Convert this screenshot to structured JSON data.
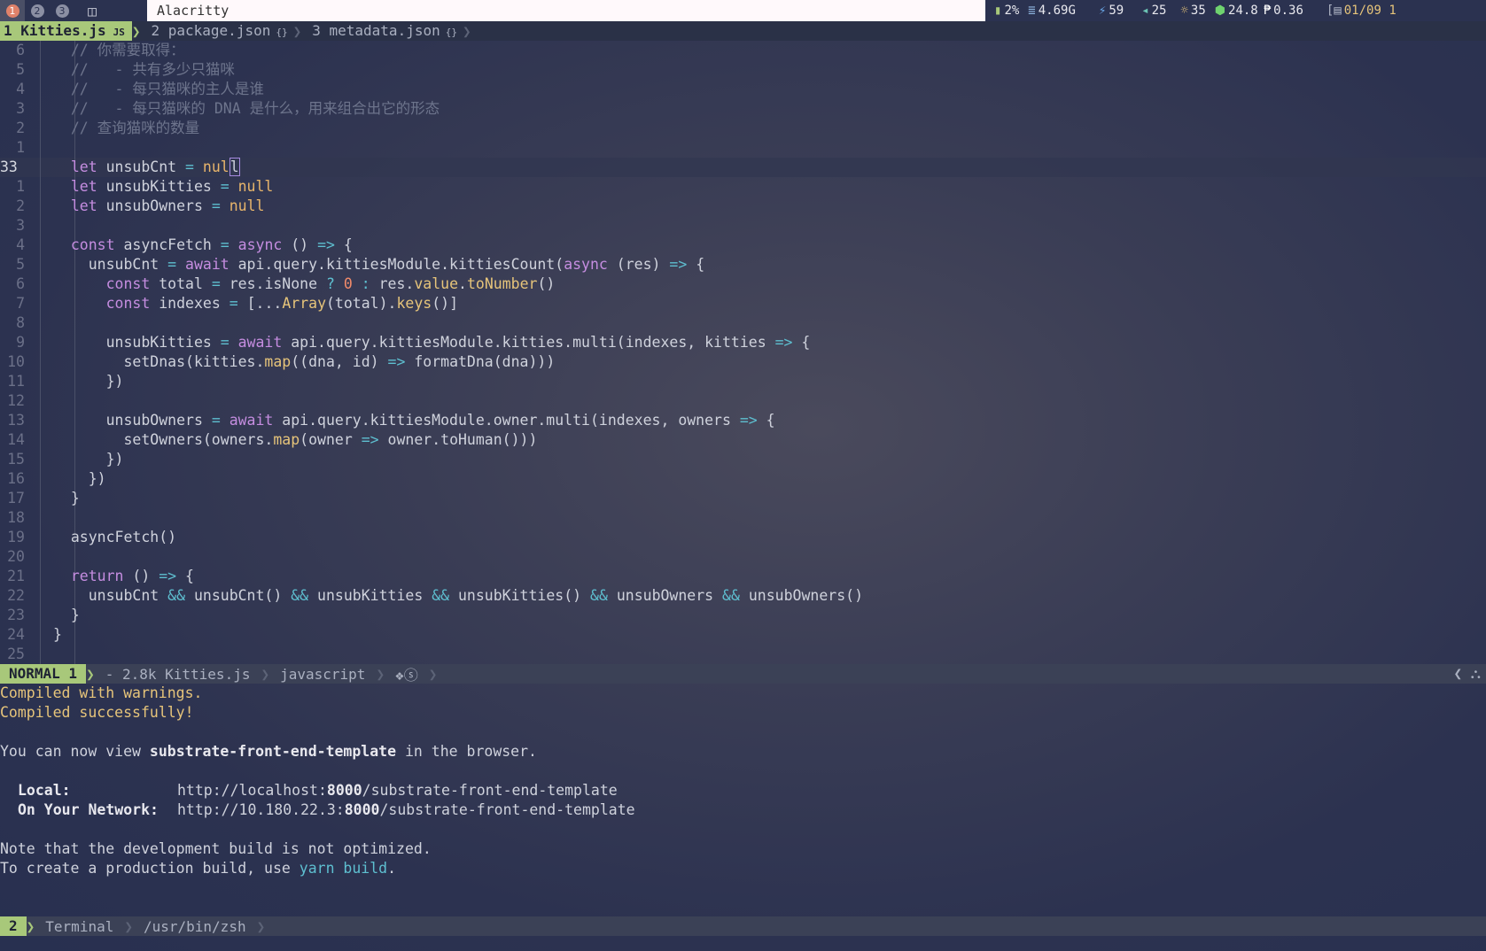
{
  "topbar": {
    "workspaces": [
      "1",
      "2",
      "3"
    ],
    "window_title": "Alacritty",
    "status": {
      "battery": "2%",
      "memory": "4.69G",
      "power": "59",
      "volume": "25",
      "brightness": "35",
      "temp": "24.8",
      "load": "0.36",
      "date": "01/09 1"
    }
  },
  "tabs": [
    {
      "label": "1 Kitties.js",
      "badge": "JS"
    },
    {
      "label": "2 package.json",
      "badge": "{}"
    },
    {
      "label": "3 metadata.json",
      "badge": "{}"
    }
  ],
  "editor": {
    "lines": [
      {
        "n": "6",
        "tokens": [
          [
            "cm",
            "  // 你需要取得："
          ]
        ]
      },
      {
        "n": "5",
        "tokens": [
          [
            "cm",
            "  //   - 共有多少只猫咪"
          ]
        ]
      },
      {
        "n": "4",
        "tokens": [
          [
            "cm",
            "  //   - 每只猫咪的主人是谁"
          ]
        ]
      },
      {
        "n": "3",
        "tokens": [
          [
            "cm",
            "  //   - 每只猫咪的 DNA 是什么，用来组合出它的形态"
          ]
        ]
      },
      {
        "n": "2",
        "tokens": [
          [
            "cm",
            "  // 查询猫咪的数量"
          ]
        ]
      },
      {
        "n": "1",
        "tokens": []
      },
      {
        "n": "33",
        "cur": true,
        "tokens": [
          [
            "kw",
            "  let "
          ],
          [
            "pl",
            "unsubCnt "
          ],
          [
            "op",
            "= "
          ],
          [
            "nl",
            "nul"
          ],
          [
            "cursor",
            "l"
          ]
        ]
      },
      {
        "n": "1",
        "tokens": [
          [
            "kw",
            "  let "
          ],
          [
            "pl",
            "unsubKitties "
          ],
          [
            "op",
            "= "
          ],
          [
            "nl",
            "null"
          ]
        ]
      },
      {
        "n": "2",
        "tokens": [
          [
            "kw",
            "  let "
          ],
          [
            "pl",
            "unsubOwners "
          ],
          [
            "op",
            "= "
          ],
          [
            "nl",
            "null"
          ]
        ]
      },
      {
        "n": "3",
        "tokens": []
      },
      {
        "n": "4",
        "tokens": [
          [
            "kw",
            "  const "
          ],
          [
            "pl",
            "asyncFetch "
          ],
          [
            "op",
            "= "
          ],
          [
            "kw",
            "async "
          ],
          [
            "pl",
            "() "
          ],
          [
            "op",
            "=> "
          ],
          [
            "pl",
            "{"
          ]
        ]
      },
      {
        "n": "5",
        "tokens": [
          [
            "pl",
            "    unsubCnt "
          ],
          [
            "op",
            "= "
          ],
          [
            "kw",
            "await "
          ],
          [
            "pl",
            "api.query.kittiesModule.kittiesCount("
          ],
          [
            "kw",
            "async "
          ],
          [
            "pl",
            "(res) "
          ],
          [
            "op",
            "=> "
          ],
          [
            "pl",
            "{"
          ]
        ]
      },
      {
        "n": "6",
        "tokens": [
          [
            "kw",
            "      const "
          ],
          [
            "pl",
            "total "
          ],
          [
            "op",
            "= "
          ],
          [
            "pl",
            "res.isNone "
          ],
          [
            "op",
            "? "
          ],
          [
            "nm",
            "0 "
          ],
          [
            "op",
            ": "
          ],
          [
            "pl",
            "res."
          ],
          [
            "fn",
            "value"
          ],
          [
            "pl",
            "."
          ],
          [
            "fn",
            "toNumber"
          ],
          [
            "pl",
            "()"
          ]
        ]
      },
      {
        "n": "7",
        "tokens": [
          [
            "kw",
            "      const "
          ],
          [
            "pl",
            "indexes "
          ],
          [
            "op",
            "= "
          ],
          [
            "pl",
            "[..."
          ],
          [
            "fn",
            "Array"
          ],
          [
            "pl",
            "(total)."
          ],
          [
            "fn",
            "keys"
          ],
          [
            "pl",
            "()]"
          ]
        ]
      },
      {
        "n": "8",
        "tokens": []
      },
      {
        "n": "9",
        "tokens": [
          [
            "pl",
            "      unsubKitties "
          ],
          [
            "op",
            "= "
          ],
          [
            "kw",
            "await "
          ],
          [
            "pl",
            "api.query.kittiesModule.kitties.multi(indexes, kitties "
          ],
          [
            "op",
            "=> "
          ],
          [
            "pl",
            "{"
          ]
        ]
      },
      {
        "n": "10",
        "tokens": [
          [
            "pl",
            "        setDnas(kitties."
          ],
          [
            "fn",
            "map"
          ],
          [
            "pl",
            "((dna, id) "
          ],
          [
            "op",
            "=> "
          ],
          [
            "pl",
            "formatDna(dna)))"
          ]
        ]
      },
      {
        "n": "11",
        "tokens": [
          [
            "pl",
            "      })"
          ]
        ]
      },
      {
        "n": "12",
        "tokens": []
      },
      {
        "n": "13",
        "tokens": [
          [
            "pl",
            "      unsubOwners "
          ],
          [
            "op",
            "= "
          ],
          [
            "kw",
            "await "
          ],
          [
            "pl",
            "api.query.kittiesModule.owner.multi(indexes, owners "
          ],
          [
            "op",
            "=> "
          ],
          [
            "pl",
            "{"
          ]
        ]
      },
      {
        "n": "14",
        "tokens": [
          [
            "pl",
            "        setOwners(owners."
          ],
          [
            "fn",
            "map"
          ],
          [
            "pl",
            "(owner "
          ],
          [
            "op",
            "=> "
          ],
          [
            "pl",
            "owner.toHuman()))"
          ]
        ]
      },
      {
        "n": "15",
        "tokens": [
          [
            "pl",
            "      })"
          ]
        ]
      },
      {
        "n": "16",
        "tokens": [
          [
            "pl",
            "    })"
          ]
        ]
      },
      {
        "n": "17",
        "tokens": [
          [
            "pl",
            "  }"
          ]
        ]
      },
      {
        "n": "18",
        "tokens": []
      },
      {
        "n": "19",
        "tokens": [
          [
            "pl",
            "  asyncFetch()"
          ]
        ]
      },
      {
        "n": "20",
        "tokens": []
      },
      {
        "n": "21",
        "tokens": [
          [
            "kw",
            "  return "
          ],
          [
            "pl",
            "() "
          ],
          [
            "op",
            "=> "
          ],
          [
            "pl",
            "{"
          ]
        ]
      },
      {
        "n": "22",
        "tokens": [
          [
            "pl",
            "    unsubCnt "
          ],
          [
            "op",
            "&& "
          ],
          [
            "pl",
            "unsubCnt() "
          ],
          [
            "op",
            "&& "
          ],
          [
            "pl",
            "unsubKitties "
          ],
          [
            "op",
            "&& "
          ],
          [
            "pl",
            "unsubKitties() "
          ],
          [
            "op",
            "&& "
          ],
          [
            "pl",
            "unsubOwners "
          ],
          [
            "op",
            "&& "
          ],
          [
            "pl",
            "unsubOwners()"
          ]
        ]
      },
      {
        "n": "23",
        "tokens": [
          [
            "pl",
            "  }"
          ]
        ]
      },
      {
        "n": "24",
        "tokens": [
          [
            "pl",
            "}"
          ]
        ]
      },
      {
        "n": "25",
        "tokens": []
      }
    ]
  },
  "statusline": {
    "mode": "NORMAL 1",
    "file": "- 2.8k Kitties.js",
    "filetype": "javascript"
  },
  "terminal": {
    "warn": "Compiled with warnings.",
    "ok": "Compiled successfully!",
    "view_pre": "You can now view ",
    "view_app": "substrate-front-end-template",
    "view_post": " in the browser.",
    "local_label": "Local:",
    "local_pre": "http://localhost:",
    "local_port": "8000",
    "local_post": "/substrate-front-end-template",
    "net_label": "On Your Network:",
    "net_pre": "http://10.180.22.3:",
    "net_port": "8000",
    "net_post": "/substrate-front-end-template",
    "note": "Note that the development build is not optimized.",
    "prod_pre": "To create a production build, use ",
    "prod_cmd": "yarn build",
    "prod_post": "."
  },
  "termline": {
    "num": "2",
    "title": "Terminal",
    "shell": "/usr/bin/zsh"
  }
}
